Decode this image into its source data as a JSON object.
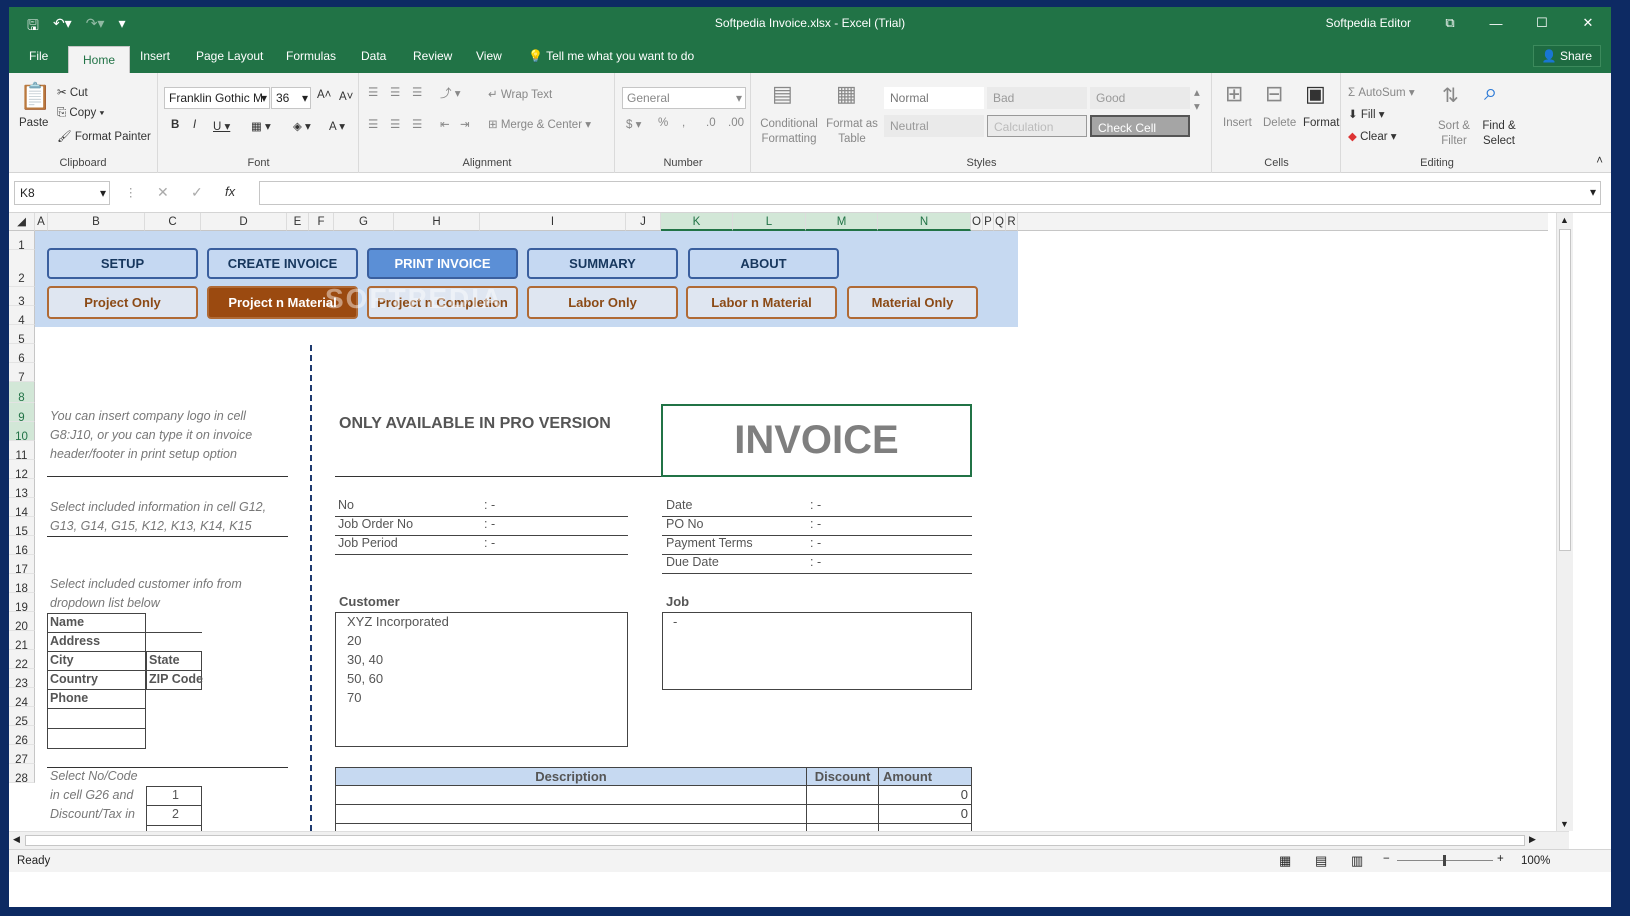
{
  "window": {
    "title": "Softpedia Invoice.xlsx - Excel (Trial)",
    "user": "Softpedia Editor",
    "share": "Share"
  },
  "tabs": [
    "File",
    "Home",
    "Insert",
    "Page Layout",
    "Formulas",
    "Data",
    "Review",
    "View"
  ],
  "tell_me": "Tell me what you want to do",
  "clipboard": {
    "paste": "Paste",
    "cut": "Cut",
    "copy": "Copy",
    "format_painter": "Format Painter",
    "label": "Clipboard"
  },
  "font": {
    "name": "Franklin Gothic M",
    "size": "36",
    "label": "Font"
  },
  "alignment": {
    "wrap": "Wrap Text",
    "merge": "Merge & Center",
    "label": "Alignment"
  },
  "number": {
    "format": "General",
    "label": "Number"
  },
  "styles": {
    "cond": "Conditional Formatting",
    "table": "Format as Table",
    "normal": "Normal",
    "bad": "Bad",
    "good": "Good",
    "neutral": "Neutral",
    "calculation": "Calculation",
    "check": "Check Cell",
    "label": "Styles"
  },
  "cells": {
    "insert": "Insert",
    "delete": "Delete",
    "format": "Format",
    "label": "Cells"
  },
  "editing": {
    "autosum": "AutoSum",
    "fill": "Fill",
    "clear": "Clear",
    "sort": "Sort & Filter",
    "find": "Find & Select",
    "label": "Editing"
  },
  "namebox": "K8",
  "columns": [
    "A",
    "B",
    "C",
    "D",
    "E",
    "F",
    "G",
    "H",
    "I",
    "J",
    "K",
    "L",
    "M",
    "N",
    "O",
    "P",
    "Q",
    "R"
  ],
  "rows": [
    "1",
    "2",
    "3",
    "4",
    "5",
    "6",
    "7",
    "8",
    "9",
    "10",
    "11",
    "12",
    "13",
    "14",
    "15",
    "16",
    "17",
    "18",
    "19",
    "20",
    "21",
    "22",
    "23",
    "24",
    "25",
    "26",
    "27",
    "28"
  ],
  "nav": [
    "SETUP",
    "CREATE INVOICE",
    "PRINT INVOICE",
    "SUMMARY",
    "ABOUT"
  ],
  "subnav": [
    "Project Only",
    "Project n Material",
    "Project n Completion",
    "Labor Only",
    "Labor n Material",
    "Material Only"
  ],
  "notes": {
    "logo1": "You can insert company logo in cell",
    "logo2": "G8:J10, or you can type it on invoice",
    "logo3": "header/footer in print setup option",
    "info1": "Select included information in cell G12,",
    "info2": "G13, G14, G15, K12, K13, K14, K15",
    "cust1": "Select included customer info from",
    "cust2": "dropdown list below",
    "code1": "Select No/Code",
    "code2": "in cell G26 and",
    "code3": "Discount/Tax in"
  },
  "pro": "ONLY AVAILABLE IN PRO VERSION",
  "invoice": "INVOICE",
  "left_fields": [
    {
      "label": "No",
      "value": ": -"
    },
    {
      "label": "Job Order No",
      "value": ": -"
    },
    {
      "label": "Job Period",
      "value": ": -"
    }
  ],
  "right_fields": [
    {
      "label": "Date",
      "value": ": -"
    },
    {
      "label": "PO No",
      "value": ": -"
    },
    {
      "label": "Payment  Terms",
      "value": ": -"
    },
    {
      "label": "Due Date",
      "value": ": -"
    }
  ],
  "customer": {
    "title": "Customer",
    "lines": [
      "XYZ Incorporated",
      "20",
      "30, 40",
      "50, 60",
      "70"
    ]
  },
  "job": {
    "title": "Job",
    "value": "-"
  },
  "cust_fields": {
    "name": "Name",
    "address": "Address",
    "city": "City",
    "state": "State",
    "country": "Country",
    "zip": "ZIP Code",
    "phone": "Phone"
  },
  "codes": [
    "1",
    "2"
  ],
  "table": {
    "desc": "Description",
    "discount": "Discount",
    "amount": "Amount",
    "values": [
      "0",
      "0"
    ]
  },
  "watermark": "SOFTPEDIA",
  "status": {
    "ready": "Ready",
    "zoom": "100%"
  }
}
